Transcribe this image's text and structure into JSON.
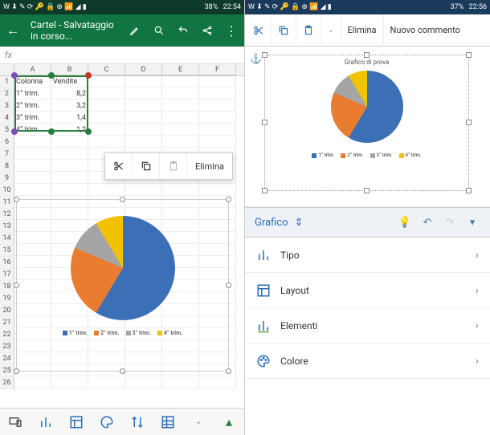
{
  "status_left": {
    "icons": "W ⬇ ✎ ⟳ 🔑 🔒 ⊕ 📶 ◢ ▮ ",
    "pct": "38%",
    "time": "22:54"
  },
  "status_right": {
    "icons": "W ⬇ ✎ ⟳ 🔑 🔒 ⊕ 📶 ◢ ▮ ",
    "pct": "37%",
    "time": "22:56"
  },
  "appbar": {
    "title": "Cartel - Salvataggio in corso..."
  },
  "fx": "fx",
  "cols": [
    "A",
    "B",
    "C",
    "D",
    "E",
    "F"
  ],
  "rows": [
    "1",
    "2",
    "3",
    "4",
    "5",
    "6",
    "7",
    "8",
    "9",
    "10",
    "11",
    "12",
    "13",
    "14",
    "15",
    "16",
    "17",
    "18",
    "19",
    "20",
    "21",
    "22",
    "23",
    "24",
    "25",
    "26"
  ],
  "cells": {
    "A1": "Colonna",
    "B1": "Vendite",
    "A2": "1° trim.",
    "B2": "8,2",
    "A3": "2° trim.",
    "B3": "3,2",
    "A4": "3° trim.",
    "B4": "1,4",
    "A5": "4° trim.",
    "B5": "1,2"
  },
  "popup": {
    "elimina": "Elimina"
  },
  "legend": [
    "1° trim.",
    "2° trim.",
    "3° trim.",
    "4° trim."
  ],
  "chart_data": {
    "type": "pie",
    "title": "Grafico di prova",
    "categories": [
      "1° trim.",
      "2° trim.",
      "3° trim.",
      "4° trim."
    ],
    "values": [
      8.2,
      3.2,
      1.4,
      1.2
    ],
    "colors": [
      "#3b6fb6",
      "#e97c2f",
      "#a5a5a5",
      "#f2c200"
    ]
  },
  "rtool": {
    "elimina": "Elimina",
    "nuovo": "Nuovo commento"
  },
  "panel": {
    "header": "Grafico"
  },
  "menu": {
    "tipo": "Tipo",
    "layout": "Layout",
    "elementi": "Elementi",
    "colore": "Colore"
  }
}
